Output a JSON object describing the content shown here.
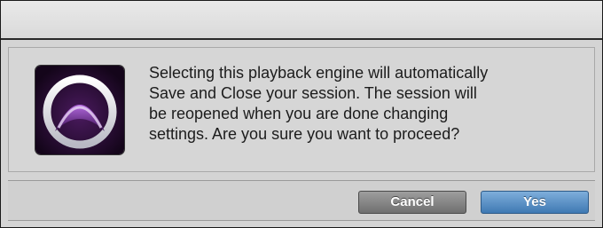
{
  "dialog": {
    "message": "Selecting this playback engine will automatically\nSave and Close your session.  The session will\nbe reopened when you are done changing\nsettings.  Are you sure you want to proceed?",
    "icon": "pro-tools-app-icon"
  },
  "buttons": {
    "cancel_label": "Cancel",
    "yes_label": "Yes"
  },
  "colors": {
    "yes_button": "#4f89c2",
    "cancel_button": "#858585",
    "icon_background": "#2a0f33",
    "icon_accent": "#7a2fae"
  }
}
